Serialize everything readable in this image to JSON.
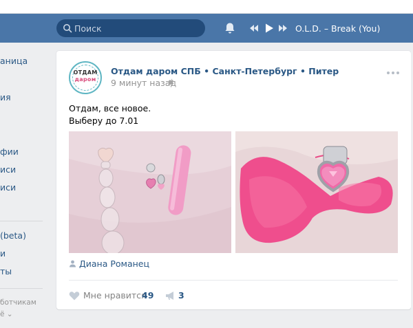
{
  "header": {
    "search_placeholder": "Поиск",
    "player": {
      "track": "O.L.D. – Break (You)"
    }
  },
  "sidebar": {
    "items": [
      {
        "label": "аница"
      },
      {
        "label": "ия"
      },
      {
        "label": "фии"
      },
      {
        "label": "иси"
      },
      {
        "label": "иси"
      },
      {
        "label": "(beta)"
      },
      {
        "label": "и"
      },
      {
        "label": "ты"
      }
    ],
    "footer": {
      "line1": "ботчикам",
      "line2": "ё ⌄"
    }
  },
  "post": {
    "author": "Отдам даром СПБ • Санкт-Петербург • Питер",
    "time": "9 минут назад",
    "avatar": {
      "line1": "ОТДАМ",
      "line2": "даром"
    },
    "text": [
      "Отдам, все новое.",
      "Выберу до 7.01"
    ],
    "signer": "Диана Романец",
    "like_label": "Мне нравится",
    "likes": "49",
    "shares": "3"
  },
  "colors": {
    "header": "#4a76a8",
    "link": "#2a5885",
    "muted": "#939393",
    "page_bg": "#edeef0"
  },
  "icons": [
    "search-icon",
    "bell-icon",
    "prev-icon",
    "play-icon",
    "next-icon",
    "apple-icon",
    "more-icon",
    "user-icon",
    "heart-icon",
    "share-icon"
  ]
}
